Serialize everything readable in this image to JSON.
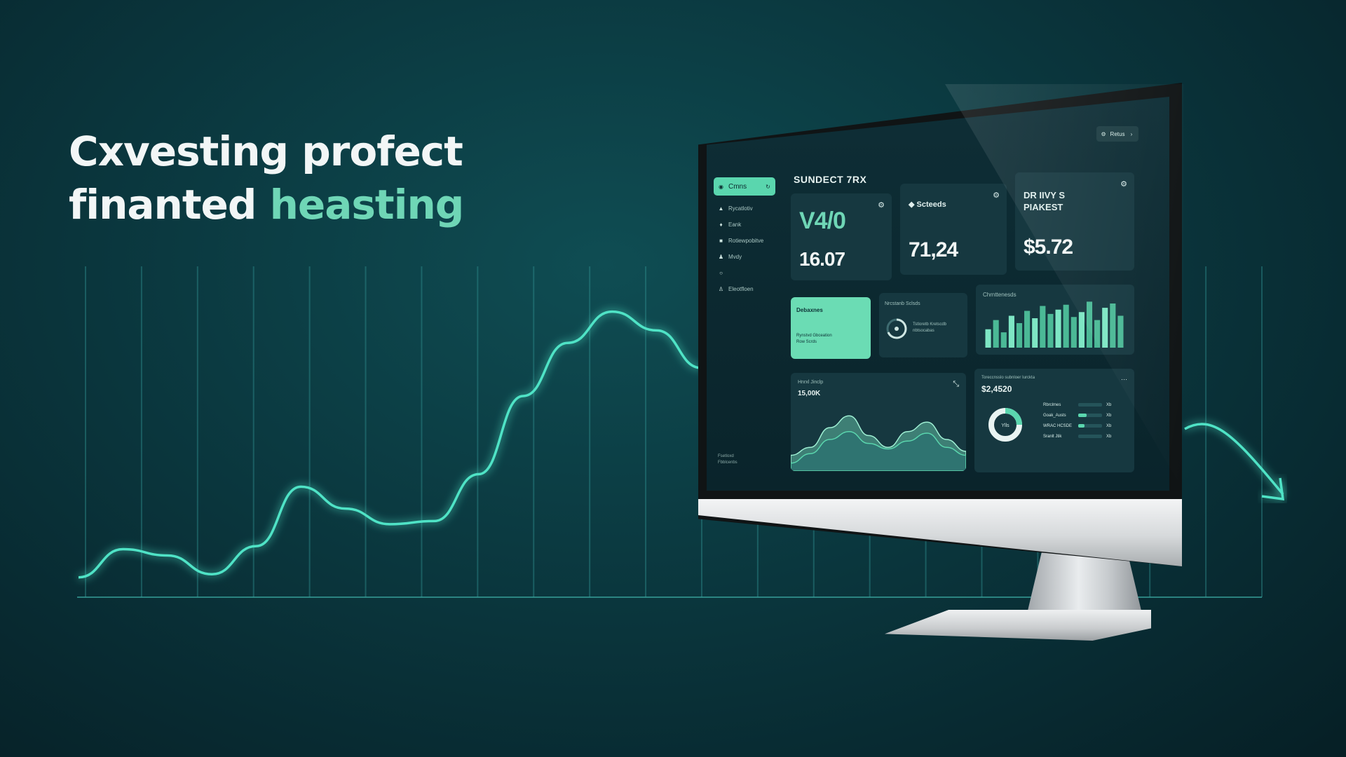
{
  "headline": {
    "line1": "Cxvesting profect",
    "line2_plain": "finanted ",
    "line2_accent": "heasting"
  },
  "colors": {
    "background": "#0b3a41",
    "accent": "#6fd6b6",
    "glow_line": "#4fe3c6",
    "screen_bg": "#0e2e36"
  },
  "background_chart": {
    "line_points": [
      5,
      14,
      12,
      6,
      15,
      34,
      27,
      22,
      23,
      38,
      63,
      80,
      90,
      84,
      72
    ],
    "grid_lines": 22
  },
  "dashboard": {
    "page_title": "SUNDECT 7RX",
    "topbar_button": {
      "label": "Retus",
      "icon": "gear-icon"
    },
    "sidebar": {
      "active": {
        "label": "Cmns",
        "icon": "grid-icon"
      },
      "items": [
        {
          "label": "Rycatlotiv",
          "icon": "user-icon"
        },
        {
          "label": "Eank",
          "icon": "bell-icon"
        },
        {
          "label": "Rotiewpobitve",
          "icon": "doc-icon"
        },
        {
          "label": "Mvdy",
          "icon": "people-icon"
        },
        {
          "label": "",
          "icon": "circle-icon"
        },
        {
          "label": "Eleotfloen",
          "icon": "person-icon"
        }
      ],
      "footer": [
        "Fsetloxd",
        "Fbblcenbs"
      ]
    },
    "cards": {
      "card1": {
        "big": "V4/0",
        "value": "16.07"
      },
      "card2": {
        "label": "Scteeds",
        "value": "71,24"
      },
      "card3": {
        "label_line1": "DR IIVY S",
        "label_line2": "PIAKEST",
        "value": "$5.72"
      },
      "mint": {
        "title": "Debaxnes",
        "sub1": "Rynstvd Gbceation",
        "sub2": "Row Scrds"
      },
      "gauge": {
        "title": "Nrcstanb Sclsds",
        "desc1": "Tstloretb Kretscdb",
        "desc2": "nbtsocabas"
      },
      "bars": {
        "title": "Chrnttenesds",
        "values": [
          30,
          45,
          25,
          52,
          40,
          60,
          48,
          68,
          55,
          62,
          70,
          50,
          58,
          75,
          45,
          65,
          72,
          52
        ]
      },
      "area": {
        "title": "Hnrxl Jinclp",
        "value": "15,00K",
        "series1": [
          20,
          30,
          55,
          70,
          45,
          30,
          50,
          62,
          40,
          25
        ],
        "series2": [
          10,
          22,
          40,
          50,
          35,
          28,
          38,
          48,
          30,
          20
        ]
      },
      "donut": {
        "title": "Toreccnsslo subnloer Iurckta",
        "value": "$2,4520",
        "center": "Ylls",
        "legend": [
          {
            "label": "Rbrclmes",
            "pct": 0.0,
            "right": "Xb"
          },
          {
            "label": "Goak_Austs",
            "pct": 0.35,
            "right": "Xb"
          },
          {
            "label": "WRAC HCSDE",
            "pct": 0.25,
            "right": "Xb"
          },
          {
            "label": "Sranlt Jtik",
            "pct": 0.0,
            "right": "Xb"
          }
        ]
      }
    }
  }
}
